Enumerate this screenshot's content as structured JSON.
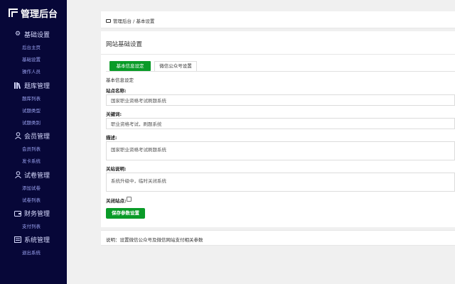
{
  "sidebar": {
    "title": "管理后台",
    "groups": [
      {
        "label": "基础设置",
        "icon": "gear-icon",
        "items": [
          "后台主页",
          "基础设置",
          "操作人员"
        ]
      },
      {
        "label": "题库管理",
        "icon": "books-icon",
        "items": [
          "题库列表",
          "试题类型",
          "试题类别"
        ]
      },
      {
        "label": "会员管理",
        "icon": "user-icon",
        "items": [
          "会员列表",
          "发卡系统"
        ]
      },
      {
        "label": "试卷管理",
        "icon": "user-icon",
        "items": [
          "添加试卷",
          "试卷列表"
        ]
      },
      {
        "label": "财务管理",
        "icon": "wallet-icon",
        "items": [
          "支付列表"
        ]
      },
      {
        "label": "系统管理",
        "icon": "system-icon",
        "items": [
          "退出系统"
        ]
      }
    ]
  },
  "breadcrumb": {
    "root": "管理后台",
    "separator": "/",
    "current": "基本设置"
  },
  "panel": {
    "title": "网站基础设置",
    "tabs": {
      "active": "基本信息设定",
      "other": "微信公众号设置"
    },
    "section_label": "基本信息设定",
    "fields": {
      "site_name": {
        "label": "站点名称:",
        "value": "国家职业资格考试刷题系统"
      },
      "keywords": {
        "label": "关键词:",
        "value": "职业资格考试，刷题系统"
      },
      "description": {
        "label": "描述:",
        "value": "国家职业资格考试刷题系统"
      },
      "close_notice": {
        "label": "关站说明:",
        "value": "系统升级中，临时关闭系统"
      },
      "close_site": {
        "label": "关闭站点:",
        "checked": false
      }
    },
    "save_label": "保存参数设置"
  },
  "note": "说明：设置微信公众号及微信网站支付相关参数",
  "colors": {
    "sidebar_bg": "#070738",
    "accent_green": "#0a9b28"
  }
}
